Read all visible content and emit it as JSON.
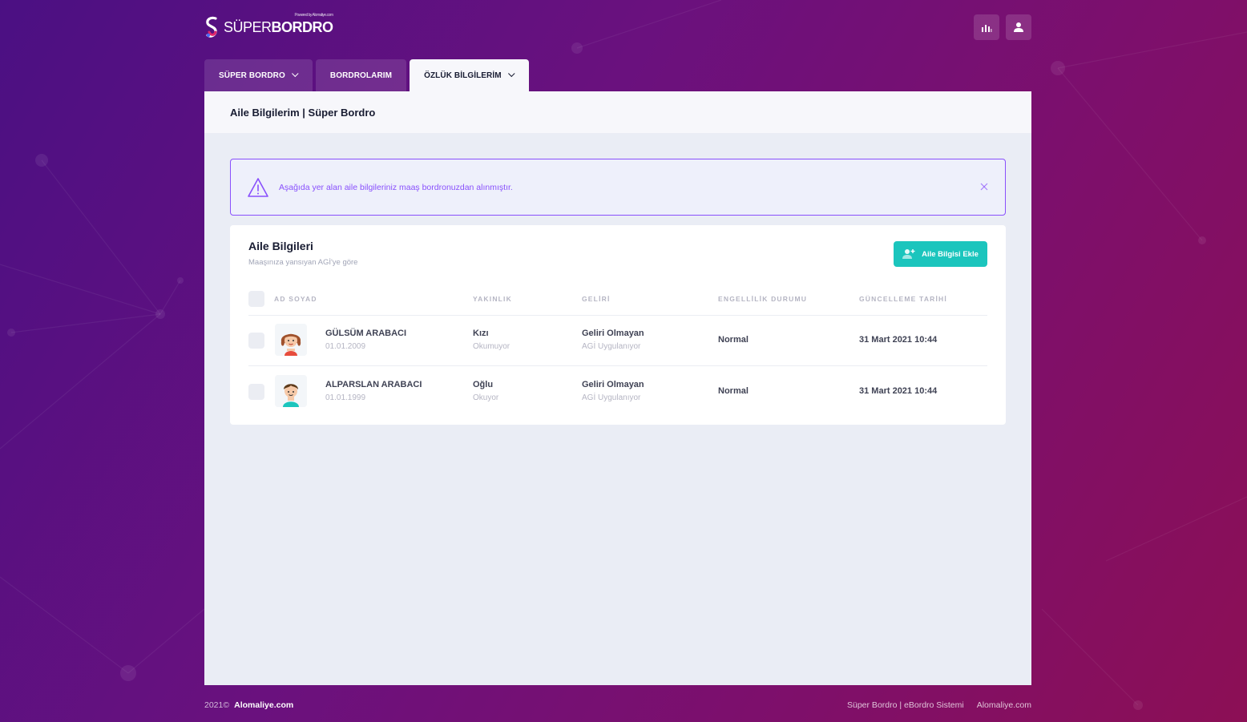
{
  "brand": {
    "light": "SÜPER",
    "bold": "BORDRO",
    "tagline": "Powered by Alomaliye.com"
  },
  "tabs": [
    {
      "label": "SÜPER BORDRO",
      "dropdown": true
    },
    {
      "label": "BORDROLARIM",
      "dropdown": false
    },
    {
      "label": "ÖZLÜK BİLGİLERİM",
      "dropdown": true,
      "active": true
    }
  ],
  "subheader": {
    "title": "Aile Bilgilerim | Süper Bordro"
  },
  "alert": {
    "text": "Aşağıda yer alan aile bilgileriniz maaş bordronuzdan alınmıştır."
  },
  "card": {
    "title": "Aile Bilgileri",
    "subtitle": "Maaşınıza yansıyan AGİ'ye göre",
    "add_button": "Aile Bilgisi Ekle",
    "columns": [
      "AD SOYAD",
      "YAKINLIK",
      "GELİRİ",
      "ENGELLİLİK DURUMU",
      "GÜNCELLEME TARİHİ"
    ],
    "rows": [
      {
        "name": "GÜLSÜM ARABACI",
        "birth": "01.01.2009",
        "relation": "Kızı",
        "edu": "Okumuyor",
        "income": "Geliri Olmayan",
        "agi": "AGİ Uygulanıyor",
        "disability": "Normal",
        "updated": "31 Mart 2021 10:44",
        "avatar": "girl-avatar"
      },
      {
        "name": "ALPARSLAN ARABACI",
        "birth": "01.01.1999",
        "relation": "Oğlu",
        "edu": "Okuyor",
        "income": "Geliri Olmayan",
        "agi": "AGİ Uygulanıyor",
        "disability": "Normal",
        "updated": "31 Mart 2021 10:44",
        "avatar": "boy-avatar"
      }
    ]
  },
  "footer": {
    "year": "2021©",
    "site": "Alomaliye.com",
    "links": [
      "Süper Bordro | eBordro Sistemi",
      "Alomaliye.com"
    ]
  },
  "colors": {
    "accent": "#8950fc",
    "success": "#1bc5bd",
    "bg_start": "#4b1083",
    "bg_end": "#8c0f55"
  }
}
